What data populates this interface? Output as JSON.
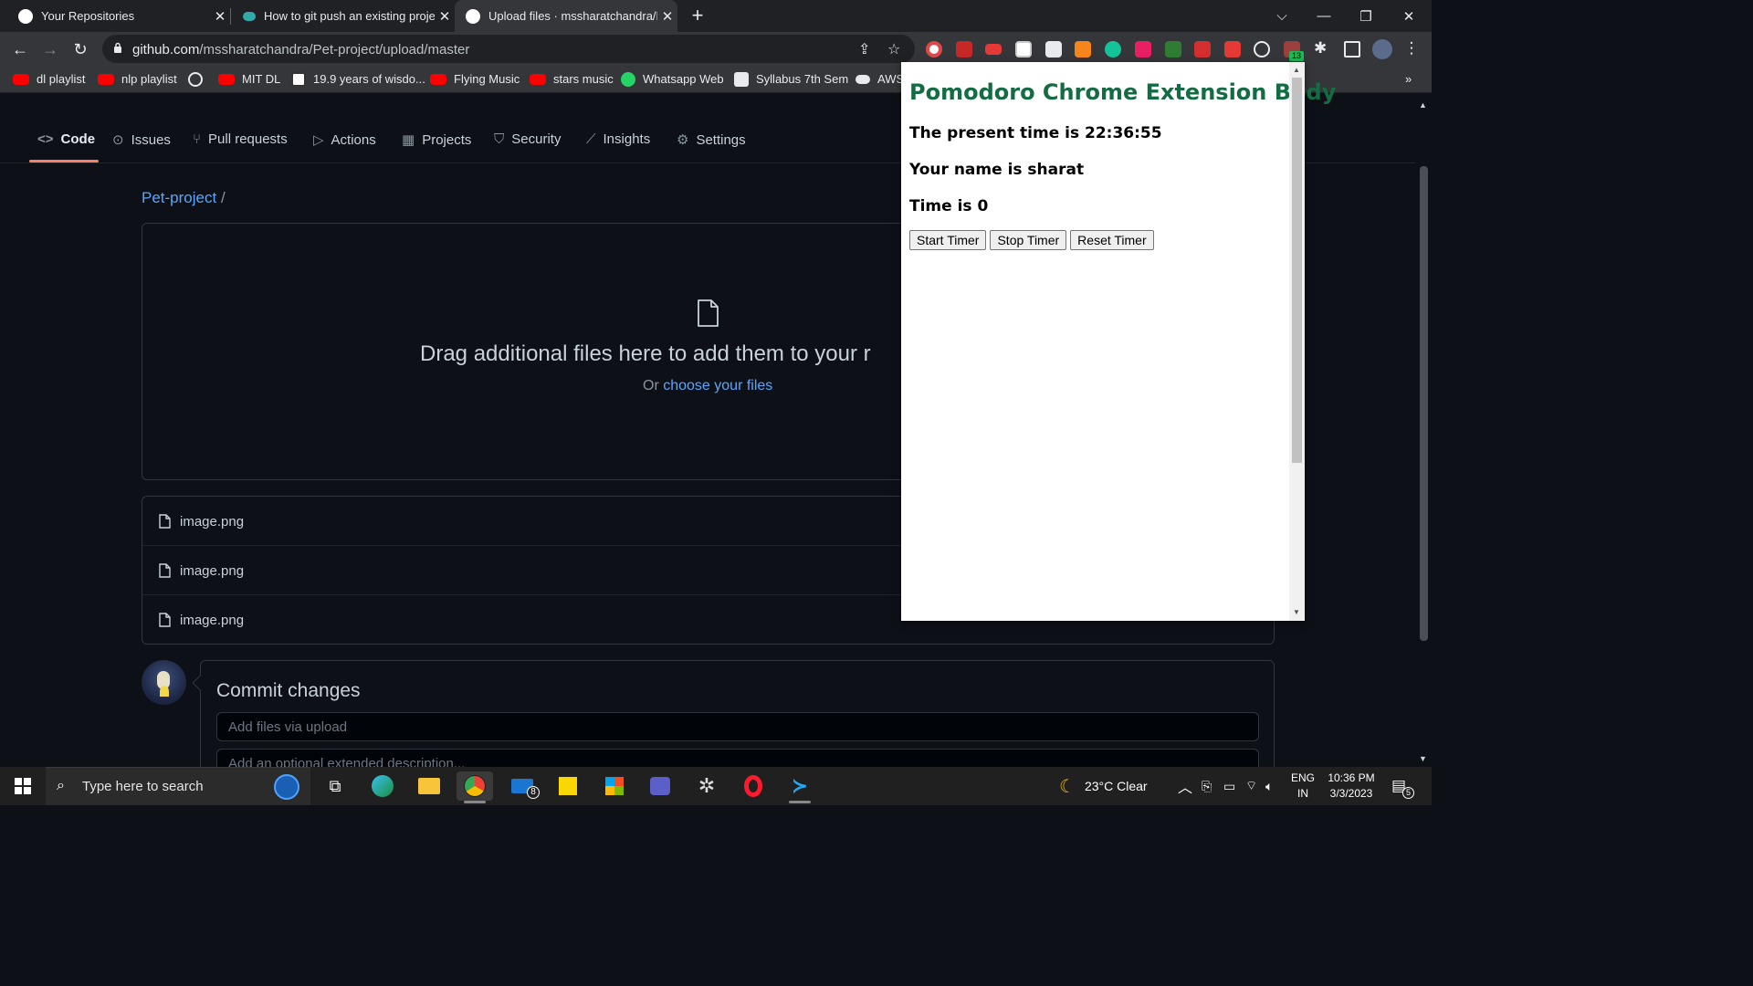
{
  "browser": {
    "tabs": [
      {
        "title": "Your Repositories",
        "icon": "github-icon",
        "active": false
      },
      {
        "title": "How to git push an existing proje",
        "icon": "educative-icon",
        "active": false
      },
      {
        "title": "Upload files · mssharatchandra/P",
        "icon": "github-icon",
        "active": true
      }
    ],
    "url_host": "github.com",
    "url_path": "/mssharatchandra/Pet-project/upload/master",
    "extension_badge": "13",
    "bookmarks": [
      {
        "label": "dl playlist",
        "icon": "youtube-icon"
      },
      {
        "label": "nlp playlist",
        "icon": "youtube-icon"
      },
      {
        "label": "",
        "icon": "globe-icon"
      },
      {
        "label": "MIT DL",
        "icon": "youtube-icon"
      },
      {
        "label": "19.9 years of wisdo...",
        "icon": "notion-icon"
      },
      {
        "label": "Flying Music",
        "icon": "youtube-icon"
      },
      {
        "label": "stars music",
        "icon": "youtube-icon"
      },
      {
        "label": "Whatsapp Web",
        "icon": "whatsapp-icon"
      },
      {
        "label": "Syllabus 7th Sem",
        "icon": "docs-icon"
      },
      {
        "label": "AWS",
        "icon": "cloud-icon"
      }
    ],
    "bookmarks_overflow": "»"
  },
  "github": {
    "nav": [
      "Code",
      "Issues",
      "Pull requests",
      "Actions",
      "Projects",
      "Security",
      "Insights",
      "Settings"
    ],
    "breadcrumb_repo": "Pet-project",
    "breadcrumb_sep": "/",
    "drop_title": "Drag additional files here to add them to your r",
    "drop_or": "Or",
    "drop_link": "choose your files",
    "files": [
      "image.png",
      "image.png",
      "image.png"
    ],
    "file_remove": "×",
    "commit_title": "Commit changes",
    "commit_placeholder": "Add files via upload",
    "commit_desc_placeholder": "Add an optional extended description..."
  },
  "popup": {
    "heading": "Pomodoro Chrome Extension Body",
    "time_line": "The present time is 22:36:55",
    "name_line": "Your name is sharat",
    "timer_line": "Time is 0",
    "buttons": [
      "Start Timer",
      "Stop Timer",
      "Reset Timer"
    ]
  },
  "taskbar": {
    "search_placeholder": "Type here to search",
    "mail_badge": "8",
    "weather": "23°C  Clear",
    "lang_top": "ENG",
    "lang_bottom": "IN",
    "time": "10:36 PM",
    "date": "3/3/2023",
    "notif_count": "5"
  },
  "colors": {
    "popup_heading": "#146c43",
    "github_bg": "#0d1117",
    "link": "#58a6ff",
    "nav_underline": "#f78166"
  }
}
